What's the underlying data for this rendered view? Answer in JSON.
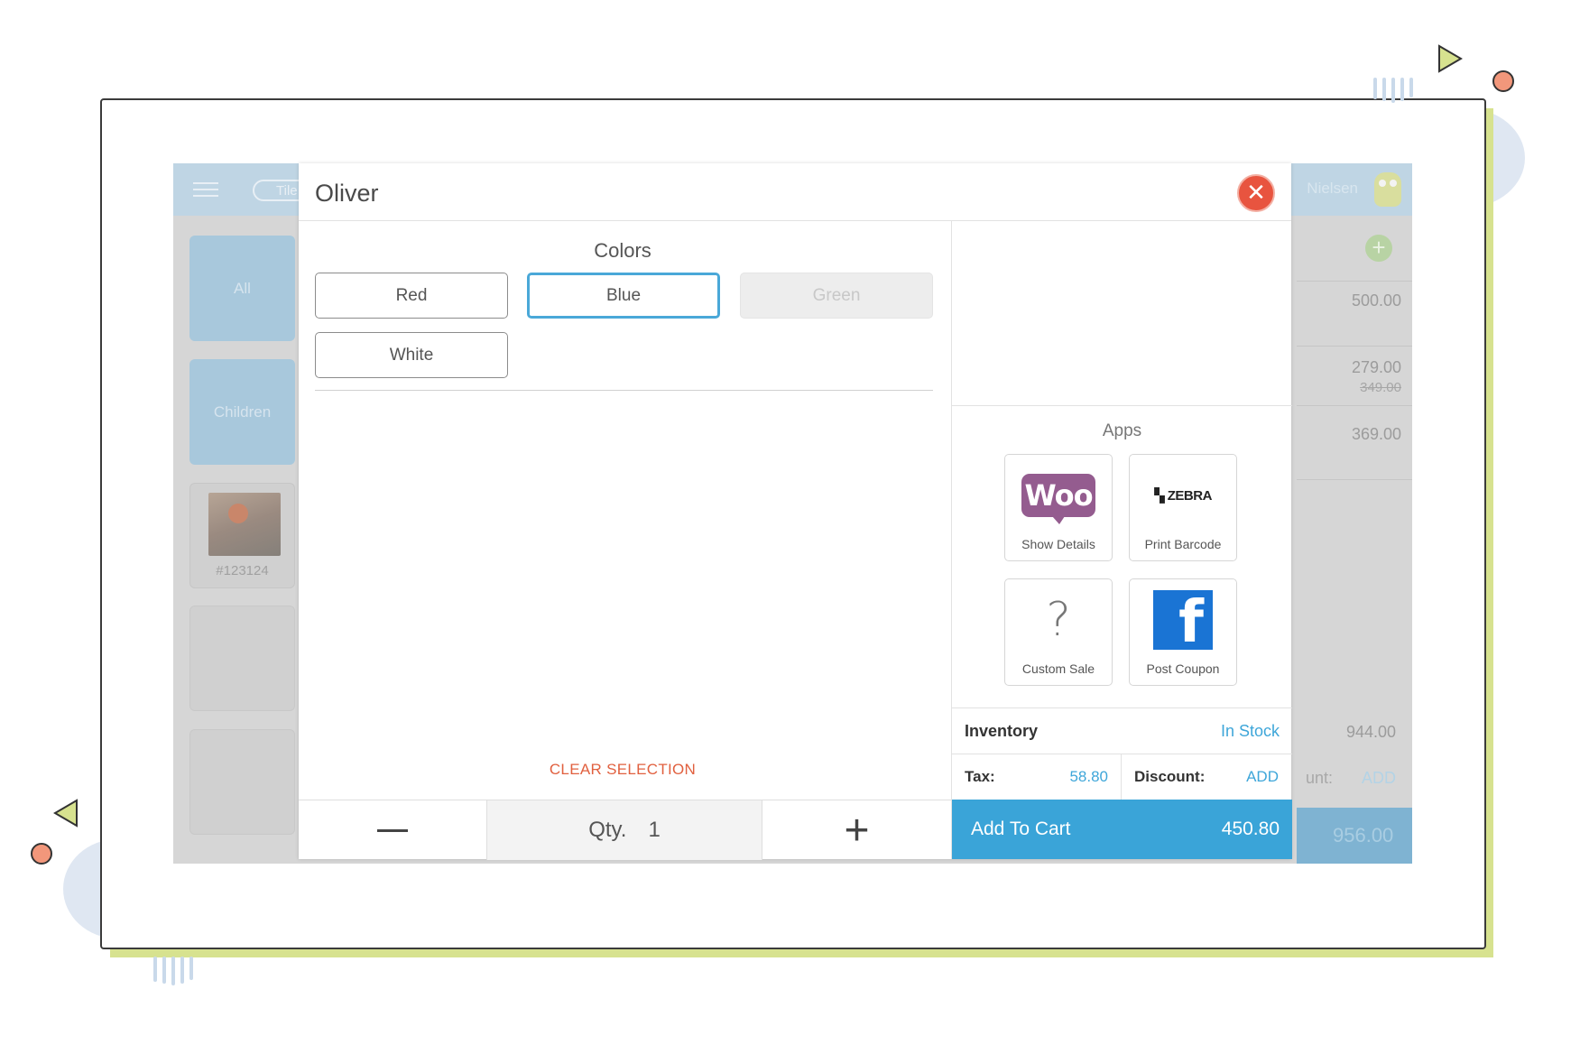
{
  "background_screen": {
    "tile_pill": "Tile",
    "sidebar": {
      "categories": [
        "All",
        "Children"
      ],
      "product_sku": "#123124"
    },
    "user_name": "Nielsen",
    "cart_prices": [
      "500.00",
      "279.00",
      "349.00",
      "369.00"
    ],
    "cart_subtotal": "944.00",
    "discount_label": "unt:",
    "discount_value": "ADD",
    "cart_total": "956.00"
  },
  "modal": {
    "title": "Oliver",
    "close_icon": "close-icon",
    "variation": {
      "label": "Colors",
      "options": [
        "Red",
        "Blue",
        "Green",
        "White"
      ],
      "selected": "Blue",
      "disabled": [
        "Green"
      ]
    },
    "clear_selection": "CLEAR SELECTION",
    "quantity": {
      "label": "Qty.",
      "value": "1",
      "minus_icon": "minus-icon",
      "plus_icon": "plus-icon"
    },
    "apps": {
      "label": "Apps",
      "items": [
        {
          "name": "Show Details",
          "icon": "woocommerce-icon",
          "logo_text": "Woo"
        },
        {
          "name": "Print Barcode",
          "icon": "zebra-icon",
          "logo_text": "ZEBRA"
        },
        {
          "name": "Custom Sale",
          "icon": "question-mark-icon",
          "logo_text": "?"
        },
        {
          "name": "Post Coupon",
          "icon": "facebook-icon",
          "logo_text": "f"
        }
      ]
    },
    "inventory": {
      "label": "Inventory",
      "value": "In Stock"
    },
    "tax": {
      "label": "Tax:",
      "value": "58.80"
    },
    "discount": {
      "label": "Discount:",
      "value": "ADD"
    },
    "add_to_cart": {
      "label": "Add To Cart",
      "price": "450.80"
    }
  },
  "colors": {
    "accent": "#3aa4d8",
    "close": "#e8543f",
    "clear": "#e1603f",
    "frame_green": "#d7e28f",
    "woo_purple": "#945c8f",
    "facebook_blue": "#1a74d4"
  }
}
